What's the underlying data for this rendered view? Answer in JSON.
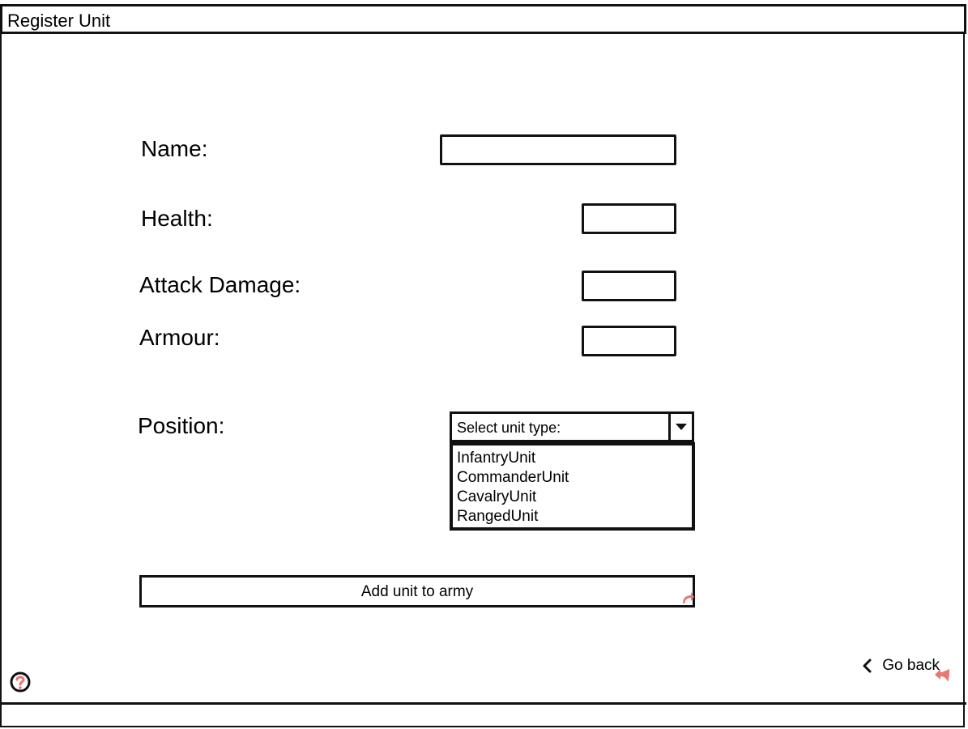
{
  "window": {
    "title": "Register Unit"
  },
  "form": {
    "name_label": "Name:",
    "name_value": "",
    "health_label": "Health:",
    "health_value": "",
    "attack_label": "Attack Damage:",
    "attack_value": "",
    "armour_label": "Armour:",
    "armour_value": "",
    "position_label": "Position:",
    "unit_type_select": {
      "value": "Select unit type:",
      "options": [
        "InfantryUnit",
        "CommanderUnit",
        "CavalryUnit",
        "RangedUnit"
      ]
    },
    "add_button_label": "Add unit to army"
  },
  "footer": {
    "back_label": "Go back",
    "help_icon": "help-icon"
  },
  "colors": {
    "ink": "#111111",
    "link_marker": "#e77872",
    "background": "#ffffff"
  }
}
